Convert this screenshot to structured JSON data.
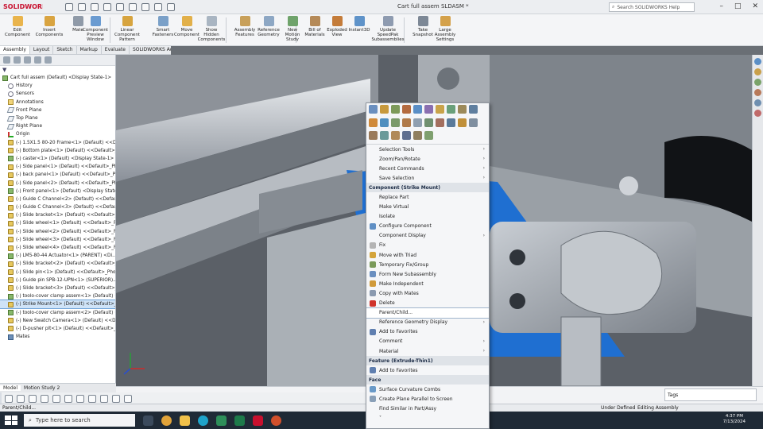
{
  "titlebar": {
    "logo": "SOLIDWORKS",
    "title": "Cart full assem SLDASM *",
    "search_placeholder": "Search SOLIDWORKS Help",
    "controls": [
      "–",
      "□",
      "✕"
    ]
  },
  "commands": [
    {
      "label": "Edit\nComponent",
      "color": "#e9b44c"
    },
    {
      "label": "Insert\nComponents",
      "color": "#d9a441"
    },
    {
      "label": "Mate",
      "color": "#8f9aa8"
    },
    {
      "label": "Component\nPreview\nWindow",
      "color": "#6a9bd1"
    },
    {
      "label": "Linear Component\nPattern",
      "color": "#d7a43f"
    },
    {
      "label": "Smart\nFasteners",
      "color": "#7aa0c8"
    },
    {
      "label": "Move\nComponent",
      "color": "#e2b04a"
    },
    {
      "label": "Show\nHidden\nComponents",
      "color": "#a9b5c2"
    },
    {
      "label": "Assembly\nFeatures",
      "color": "#c8a05a"
    },
    {
      "label": "Reference\nGeometry",
      "color": "#8da7c4"
    },
    {
      "label": "New\nMotion\nStudy",
      "color": "#6fa36b"
    },
    {
      "label": "Bill of\nMaterials",
      "color": "#b58a58"
    },
    {
      "label": "Exploded\nView",
      "color": "#c47c3a"
    },
    {
      "label": "Instant3D",
      "color": "#5f93c9"
    },
    {
      "label": "Update\nSpeedPak\nSubassemblies",
      "color": "#8e9bb0"
    },
    {
      "label": "Take\nSnapshot",
      "color": "#7d8896"
    },
    {
      "label": "Large\nAssembly\nSettings",
      "color": "#d4a14a"
    }
  ],
  "tabs": [
    "Assembly",
    "Layout",
    "Sketch",
    "Markup",
    "Evaluate",
    "SOLIDWORKS Add-Ins"
  ],
  "tree": [
    {
      "label": "Cart full assem (Default) <Display State-1>",
      "icon": "sub",
      "indent": 0
    },
    {
      "label": "History",
      "icon": "hist",
      "indent": 1
    },
    {
      "label": "Sensors",
      "icon": "hist",
      "indent": 1
    },
    {
      "label": "Annotations",
      "icon": "folder",
      "indent": 1
    },
    {
      "label": "Front Plane",
      "icon": "plane",
      "indent": 1
    },
    {
      "label": "Top Plane",
      "icon": "plane",
      "indent": 1
    },
    {
      "label": "Right Plane",
      "icon": "plane",
      "indent": 1
    },
    {
      "label": "Origin",
      "icon": "origin",
      "indent": 1
    },
    {
      "label": "(-) 1.5X1.5 80-20 Frame<1> (Default) <<Disp...",
      "icon": "part",
      "indent": 1
    },
    {
      "label": "(-) Bottom plate<1> (Default) <<Default>_Pl...",
      "icon": "part",
      "indent": 1
    },
    {
      "label": "(-) caster<1> (Default) <Display State-1>",
      "icon": "sub",
      "indent": 1
    },
    {
      "label": "(-) Side panel<1> (Default) <<Default>_Pho...",
      "icon": "part",
      "indent": 1
    },
    {
      "label": "(-) back panel<1> (Default) <<Default>_Pho...",
      "icon": "part",
      "indent": 1
    },
    {
      "label": "(-) Side panel<2> (Default) <<Default>_Phot...",
      "icon": "part",
      "indent": 1
    },
    {
      "label": "(-) Front panel<1> (Default) <Display State-1>",
      "icon": "sub",
      "indent": 1
    },
    {
      "label": "(-) Guide C Channel<2> (Default) <<Default>...",
      "icon": "part",
      "indent": 1
    },
    {
      "label": "(-) Guide C Channel<3> (Default) <<Default>...",
      "icon": "part",
      "indent": 1
    },
    {
      "label": "(-) Slide bracket<1> (Default) <<Default>_P...",
      "icon": "part",
      "indent": 1
    },
    {
      "label": "(-) Slide wheel<1> (Default) <<Default>_Phot...",
      "icon": "part",
      "indent": 1
    },
    {
      "label": "(-) Slide wheel<2> (Default) <<Default>_Phot...",
      "icon": "part",
      "indent": 1
    },
    {
      "label": "(-) Slide wheel<3> (Default) <<Default>_Phot...",
      "icon": "part",
      "indent": 1
    },
    {
      "label": "(-) Slide wheel<4> (Default) <<Default>_Phot...",
      "icon": "part",
      "indent": 1
    },
    {
      "label": "(-) LM5-80-44 Actuator<1> (PARENT) <Di...",
      "icon": "sub",
      "indent": 1
    },
    {
      "label": "(-) Slide bracket<2> (Default) <<Default>_P...",
      "icon": "part",
      "indent": 1
    },
    {
      "label": "(-) Slide pin<1> (Default) <<Default>_Photo...",
      "icon": "part",
      "indent": 1
    },
    {
      "label": "(-) Guide pin SPB-12-UPN<1> (SUPERIOR)...",
      "icon": "part",
      "indent": 1
    },
    {
      "label": "(-) Slide bracket<3> (Default) <<Default>_P...",
      "icon": "part",
      "indent": 1
    },
    {
      "label": "(-) toolo-cover clamp assem<1> (Default) <D...",
      "icon": "sub",
      "indent": 1
    },
    {
      "label": "(-) Strike Mount<1> (Default) <<Default>_P...",
      "icon": "part",
      "indent": 1,
      "selected": true
    },
    {
      "label": "(-) toolo-cover clamp assem<2> (Default) <D...",
      "icon": "sub",
      "indent": 1
    },
    {
      "label": "(-) New Swatch Camera<1> (Default) <<Defa...",
      "icon": "part",
      "indent": 1
    },
    {
      "label": "(-) D-pusher plt<1> (Default) <<Default>_Ph...",
      "icon": "part",
      "indent": 1
    },
    {
      "label": "Mates",
      "icon": "mates",
      "indent": 1
    }
  ],
  "model_tabs": [
    "Model",
    "Motion Study 2"
  ],
  "status": {
    "left": "Parent/Child...",
    "center": "Under Defined",
    "right": "Editing Assembly"
  },
  "tags_label": "Tags",
  "taskbar": {
    "search_placeholder": "Type here to search",
    "time": "4:37 PM",
    "date": "7/13/2024"
  },
  "context_menu": {
    "tool_colors": [
      "#6a8fbf",
      "#c89a3d",
      "#7d9a5a",
      "#b36a3f",
      "#5a8ec6",
      "#8a6fb0",
      "#c9a34a",
      "#6aa07a",
      "#9c8a5a",
      "#5f7f9f",
      "#d08a3a",
      "#4f8fbf",
      "#7a9a6a",
      "#b07a4a",
      "#8f9fb0",
      "#6f8f6f",
      "#a36f5f",
      "#5a7a9a",
      "#c0903a",
      "#7f8fa0",
      "#9a7a5a",
      "#6a9a9a",
      "#b08a5a",
      "#5f6f8f",
      "#8f7f5f",
      "#7fa06f"
    ],
    "items": [
      {
        "label": "Selection Tools",
        "arrow": true
      },
      {
        "label": "Zoom/Pan/Rotate",
        "arrow": true
      },
      {
        "label": "Recent Commands",
        "arrow": true
      },
      {
        "label": "Save Selection",
        "arrow": true
      },
      {
        "label": "Component (Strike Mount)",
        "header": true
      },
      {
        "label": "Replace Part"
      },
      {
        "label": "Make Virtual"
      },
      {
        "label": "Isolate"
      },
      {
        "label": "Configure Component",
        "icon": "#5f8fc4"
      },
      {
        "label": "Component Display",
        "arrow": true
      },
      {
        "label": "Fix",
        "icon": "#b4b4b4"
      },
      {
        "label": "Move with Triad",
        "icon": "#d4a43a"
      },
      {
        "label": "Temporary Fix/Group",
        "icon": "#7a9a5a"
      },
      {
        "label": "Form New Subassembly",
        "icon": "#6a8fc0"
      },
      {
        "label": "Make Independent",
        "icon": "#d09a3a"
      },
      {
        "label": "Copy with Mates",
        "icon": "#8a9ab0"
      },
      {
        "label": "Delete",
        "icon": "#d0342c"
      },
      {
        "label": "Parent/Child...",
        "hl": true
      },
      {
        "label": "Reference Geometry Display",
        "arrow": true
      },
      {
        "label": "Add to Favorites",
        "icon": "#5f7fb0"
      },
      {
        "label": "Comment",
        "arrow": true
      },
      {
        "label": "Material",
        "arrow": true
      },
      {
        "label": "Feature (Extrude-Thin1)",
        "header": true
      },
      {
        "label": "Add to Favorites",
        "icon": "#5f7fb0"
      },
      {
        "label": "Face",
        "header": true
      },
      {
        "label": "Surface Curvature Combs",
        "icon": "#6a9ac8"
      },
      {
        "label": "Create Plane Parallel to Screen",
        "icon": "#8aa0b8"
      },
      {
        "label": "Find Similar in Part/Assy"
      },
      {
        "label": "˅"
      }
    ]
  }
}
